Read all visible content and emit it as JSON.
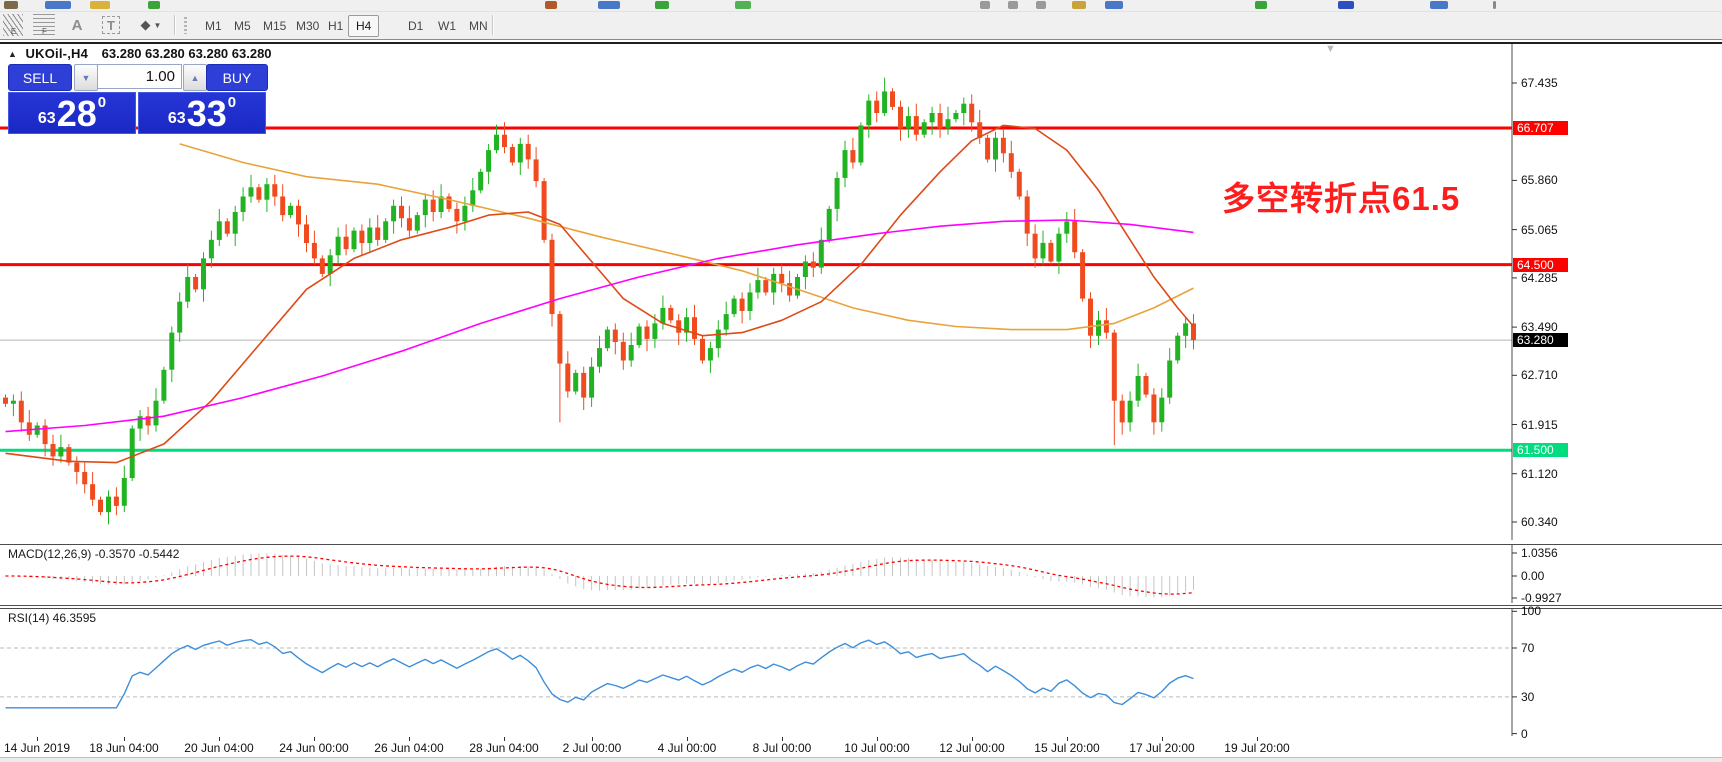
{
  "toolbar": {
    "tools": [
      {
        "name": "equidistant-channel",
        "label": "E"
      },
      {
        "name": "fibonacci-retracement",
        "label": "F"
      },
      {
        "name": "text",
        "label": "A"
      },
      {
        "name": "text-label",
        "label": "T"
      },
      {
        "name": "arrow-tools",
        "label": "▼"
      }
    ],
    "timeframes": [
      "M1",
      "M5",
      "M15",
      "M30",
      "H1",
      "H4",
      "D1",
      "W1",
      "MN"
    ],
    "active_timeframe": "H4"
  },
  "chart": {
    "collapse_icon": "▲",
    "symbol_title": "UKOil-,H4",
    "ohlc": "63.280 63.280 63.280 63.280",
    "shift_marker_icon": "▼",
    "trade_panel": {
      "sell_label": "SELL",
      "buy_label": "BUY",
      "volume": "1.00",
      "down_arrow": "▼",
      "up_arrow": "▲",
      "sell_small": "63",
      "sell_big": "28",
      "sell_sup": "0",
      "buy_small": "63",
      "buy_big": "33",
      "buy_sup": "0"
    },
    "annotation": "多空转折点61.5"
  },
  "chart_data": {
    "type": "candlestick",
    "symbol": "UKOil- H4",
    "ylim": [
      60.0,
      67.8
    ],
    "first_open": 62.35,
    "closes": [
      62.25,
      62.3,
      61.95,
      61.75,
      61.9,
      61.6,
      61.4,
      61.55,
      61.3,
      61.15,
      60.95,
      60.7,
      60.5,
      60.75,
      60.6,
      61.05,
      61.85,
      62.05,
      61.9,
      62.3,
      62.8,
      63.4,
      63.9,
      64.3,
      64.1,
      64.6,
      64.9,
      65.2,
      65.0,
      65.35,
      65.6,
      65.75,
      65.55,
      65.8,
      65.6,
      65.3,
      65.45,
      65.15,
      64.85,
      64.6,
      64.35,
      64.65,
      64.95,
      64.75,
      65.05,
      64.85,
      65.1,
      64.9,
      65.2,
      65.45,
      65.25,
      65.05,
      65.3,
      65.55,
      65.35,
      65.6,
      65.4,
      65.2,
      65.45,
      65.7,
      66.0,
      66.35,
      66.6,
      66.4,
      66.15,
      66.45,
      66.2,
      65.85,
      64.9,
      63.7,
      62.9,
      62.45,
      62.75,
      62.35,
      62.85,
      63.15,
      63.45,
      63.25,
      62.95,
      63.2,
      63.5,
      63.3,
      63.55,
      63.8,
      63.6,
      63.4,
      63.65,
      63.3,
      62.95,
      63.15,
      63.45,
      63.7,
      63.95,
      63.75,
      64.05,
      64.25,
      64.05,
      64.35,
      64.2,
      64.0,
      64.3,
      64.55,
      64.45,
      64.9,
      65.4,
      65.9,
      66.35,
      66.15,
      66.75,
      67.15,
      66.95,
      67.3,
      67.05,
      66.7,
      66.9,
      66.6,
      66.8,
      66.95,
      66.7,
      66.85,
      66.95,
      67.1,
      66.8,
      66.55,
      66.2,
      66.55,
      66.3,
      66.0,
      65.6,
      65.0,
      64.6,
      64.85,
      64.55,
      65.0,
      65.2,
      64.7,
      63.95,
      63.35,
      63.6,
      63.4,
      62.3,
      61.95,
      62.3,
      62.7,
      62.4,
      61.95,
      62.35,
      62.95,
      63.35,
      63.55,
      63.28
    ],
    "wick_overrides": {
      "62": [
        0.16,
        0.05
      ],
      "70": [
        0.05,
        0.95
      ],
      "111": [
        0.22,
        0.05
      ],
      "140": [
        0.05,
        0.72
      ]
    },
    "colors": {
      "up": "#22b322",
      "down": "#f04b1e"
    },
    "time_labels": [
      {
        "label": "14 Jun 2019",
        "bar": 4
      },
      {
        "label": "18 Jun 04:00",
        "bar": 15
      },
      {
        "label": "20 Jun 04:00",
        "bar": 27
      },
      {
        "label": "24 Jun 00:00",
        "bar": 39
      },
      {
        "label": "26 Jun 04:00",
        "bar": 51
      },
      {
        "label": "28 Jun 04:00",
        "bar": 63
      },
      {
        "label": "2 Jul 00:00",
        "bar": 74
      },
      {
        "label": "4 Jul 00:00",
        "bar": 86
      },
      {
        "label": "8 Jul 00:00",
        "bar": 98
      },
      {
        "label": "10 Jul 00:00",
        "bar": 110
      },
      {
        "label": "12 Jul 00:00",
        "bar": 122
      },
      {
        "label": "15 Jul 20:00",
        "bar": 134
      },
      {
        "label": "17 Jul 20:00",
        "bar": 146
      },
      {
        "label": "19 Jul 20:00",
        "bar": 158
      }
    ],
    "price_ticks": [
      "67.435",
      "65.860",
      "65.065",
      "64.285",
      "63.490",
      "62.710",
      "61.915",
      "61.120",
      "60.340"
    ],
    "price_lines": [
      {
        "price": 66.707,
        "label": "66.707",
        "color": "#ff0000"
      },
      {
        "price": 64.5,
        "label": "64.500",
        "color": "#ff0000"
      },
      {
        "price": 61.5,
        "label": "61.500",
        "color": "#00dc7e"
      }
    ],
    "current_price": {
      "price": 63.28,
      "label": "63.280",
      "badge_color": "#000000",
      "line_color": "#b4b4b4"
    },
    "moving_averages": [
      {
        "name": "ma-orange",
        "color": "#e8a33a",
        "points": [
          [
            22,
            66.45
          ],
          [
            30,
            66.15
          ],
          [
            38,
            65.92
          ],
          [
            47,
            65.8
          ],
          [
            56,
            65.55
          ],
          [
            66,
            65.25
          ],
          [
            75,
            64.95
          ],
          [
            85,
            64.65
          ],
          [
            93,
            64.4
          ],
          [
            100,
            64.1
          ],
          [
            107,
            63.8
          ],
          [
            114,
            63.6
          ],
          [
            120,
            63.5
          ],
          [
            127,
            63.45
          ],
          [
            134,
            63.45
          ],
          [
            140,
            63.55
          ],
          [
            145,
            63.8
          ],
          [
            150,
            64.12
          ]
        ]
      },
      {
        "name": "ma-red",
        "color": "#dd4a16",
        "points": [
          [
            0,
            61.45
          ],
          [
            8,
            61.32
          ],
          [
            14,
            61.3
          ],
          [
            20,
            61.6
          ],
          [
            26,
            62.3
          ],
          [
            32,
            63.2
          ],
          [
            38,
            64.1
          ],
          [
            44,
            64.6
          ],
          [
            50,
            64.9
          ],
          [
            56,
            65.1
          ],
          [
            61,
            65.3
          ],
          [
            66,
            65.35
          ],
          [
            70,
            65.15
          ],
          [
            74,
            64.55
          ],
          [
            78,
            63.95
          ],
          [
            83,
            63.55
          ],
          [
            88,
            63.35
          ],
          [
            93,
            63.4
          ],
          [
            98,
            63.6
          ],
          [
            103,
            63.9
          ],
          [
            108,
            64.5
          ],
          [
            113,
            65.3
          ],
          [
            118,
            66.0
          ],
          [
            122,
            66.5
          ],
          [
            126,
            66.75
          ],
          [
            130,
            66.7
          ],
          [
            134,
            66.35
          ],
          [
            138,
            65.7
          ],
          [
            142,
            64.9
          ],
          [
            145,
            64.3
          ],
          [
            148,
            63.8
          ],
          [
            150,
            63.5
          ]
        ]
      },
      {
        "name": "ma-magenta",
        "color": "#ff00ff",
        "points": [
          [
            0,
            61.8
          ],
          [
            10,
            61.9
          ],
          [
            20,
            62.05
          ],
          [
            30,
            62.35
          ],
          [
            40,
            62.7
          ],
          [
            50,
            63.1
          ],
          [
            60,
            63.55
          ],
          [
            70,
            63.95
          ],
          [
            80,
            64.3
          ],
          [
            90,
            64.6
          ],
          [
            100,
            64.82
          ],
          [
            110,
            65.0
          ],
          [
            118,
            65.12
          ],
          [
            126,
            65.2
          ],
          [
            134,
            65.22
          ],
          [
            142,
            65.15
          ],
          [
            150,
            65.02
          ]
        ]
      }
    ],
    "macd": {
      "label": "MACD(12,26,9) -0.3570 -0.5442",
      "fast": 12,
      "slow": 26,
      "signal": 9,
      "axis_labels": [
        "1.0356",
        "0.00",
        "-0.9927"
      ],
      "axis_values": [
        1.0356,
        0,
        -0.9927
      ],
      "histogram_color": "#c4c4c4",
      "signal_color": "#ff0000"
    },
    "rsi": {
      "label": "RSI(14) 46.3595",
      "period": 14,
      "axis_labels": [
        "100",
        "70",
        "30",
        "0"
      ],
      "axis_values": [
        100,
        70,
        30,
        0
      ],
      "levels": [
        70,
        30
      ],
      "line_color": "#3d8edb",
      "level_color": "#bbbbbb"
    }
  }
}
